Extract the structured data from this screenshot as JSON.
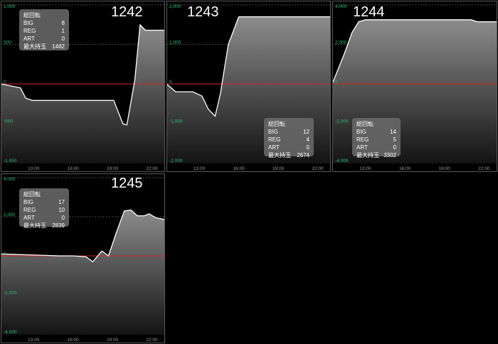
{
  "stats_labels": {
    "spins": "総回転",
    "big": "BIG",
    "reg": "REG",
    "art": "ART",
    "max": "最大持玉"
  },
  "colors": {
    "zero_line": "#d0262c",
    "tick": "#29c07a",
    "line": "#ffffff",
    "border": "#5a5a5a"
  },
  "chart_data": [
    {
      "type": "area",
      "machine_no": "1242",
      "x_ticks": [
        "13:00",
        "16:00",
        "19:00",
        "22:00"
      ],
      "y_ticks": [
        1000,
        500,
        0,
        -500,
        -1000
      ],
      "y_tick_labels": [
        "1,000",
        "500",
        "0",
        "-500",
        "-1,000"
      ],
      "ylim": [
        -1000,
        1000
      ],
      "xlim": [
        10.5,
        23.0
      ],
      "stats": {
        "big": "8",
        "reg": "1",
        "art": "0",
        "max": "1482"
      },
      "points": [
        [
          10.5,
          0
        ],
        [
          12.0,
          -50
        ],
        [
          12.4,
          -180
        ],
        [
          12.9,
          -210
        ],
        [
          19.0,
          -210
        ],
        [
          19.1,
          -210
        ],
        [
          19.8,
          -510
        ],
        [
          20.1,
          -520
        ],
        [
          20.7,
          50
        ],
        [
          21.1,
          750
        ],
        [
          21.5,
          680
        ],
        [
          23.0,
          680
        ]
      ]
    },
    {
      "type": "area",
      "machine_no": "1243",
      "x_ticks": [
        "13:00",
        "16:00",
        "19:00",
        "22:00"
      ],
      "y_ticks": [
        2000,
        1000,
        0,
        -1000,
        -2000
      ],
      "y_tick_labels": [
        "2,000",
        "1,000",
        "0",
        "-1,000",
        "-2,000"
      ],
      "ylim": [
        -2000,
        2000
      ],
      "xlim": [
        10.5,
        23.0
      ],
      "stats": {
        "big": "12",
        "reg": "4",
        "art": "0",
        "max": "2674"
      },
      "points": [
        [
          10.5,
          0
        ],
        [
          11.2,
          -200
        ],
        [
          12.5,
          -200
        ],
        [
          13.2,
          -310
        ],
        [
          13.7,
          -650
        ],
        [
          14.2,
          -820
        ],
        [
          14.6,
          -250
        ],
        [
          15.2,
          1000
        ],
        [
          16.0,
          1700
        ],
        [
          16.4,
          1700
        ],
        [
          23.0,
          1700
        ]
      ]
    },
    {
      "type": "area",
      "machine_no": "1244",
      "x_ticks": [
        "13:00",
        "16:00",
        "19:00",
        "22:00"
      ],
      "y_ticks": [
        4000,
        2000,
        0,
        -2000,
        -4000
      ],
      "y_tick_labels": [
        "4,000",
        "2,000",
        "0",
        "-2,000",
        "-4,000"
      ],
      "ylim": [
        -4000,
        4000
      ],
      "xlim": [
        10.5,
        23.0
      ],
      "stats": {
        "big": "14",
        "reg": "5",
        "art": "0",
        "max": "3302"
      },
      "points": [
        [
          10.5,
          0
        ],
        [
          11.4,
          1500
        ],
        [
          12.0,
          2600
        ],
        [
          12.5,
          3150
        ],
        [
          13.0,
          3250
        ],
        [
          16.0,
          3250
        ],
        [
          21.0,
          3250
        ],
        [
          21.5,
          3150
        ],
        [
          23.0,
          3150
        ]
      ]
    },
    {
      "type": "area",
      "machine_no": "1245",
      "x_ticks": [
        "13:00",
        "16:00",
        "19:00",
        "22:00"
      ],
      "y_ticks": [
        4000,
        2000,
        0,
        -2000,
        -4000
      ],
      "y_tick_labels": [
        "4,000",
        "2,000",
        "0",
        "-2,000",
        "-4,000"
      ],
      "ylim": [
        -4000,
        4000
      ],
      "xlim": [
        10.5,
        23.0
      ],
      "stats": {
        "big": "17",
        "reg": "10",
        "art": "0",
        "max": "2839"
      },
      "points": [
        [
          10.5,
          100
        ],
        [
          15.0,
          0
        ],
        [
          16.0,
          0
        ],
        [
          17.0,
          -50
        ],
        [
          17.5,
          -300
        ],
        [
          18.2,
          250
        ],
        [
          18.7,
          0
        ],
        [
          19.3,
          1200
        ],
        [
          19.9,
          2300
        ],
        [
          20.4,
          2350
        ],
        [
          20.9,
          2050
        ],
        [
          21.4,
          2050
        ],
        [
          21.8,
          2150
        ],
        [
          22.3,
          1950
        ],
        [
          23.0,
          1850
        ]
      ]
    }
  ]
}
